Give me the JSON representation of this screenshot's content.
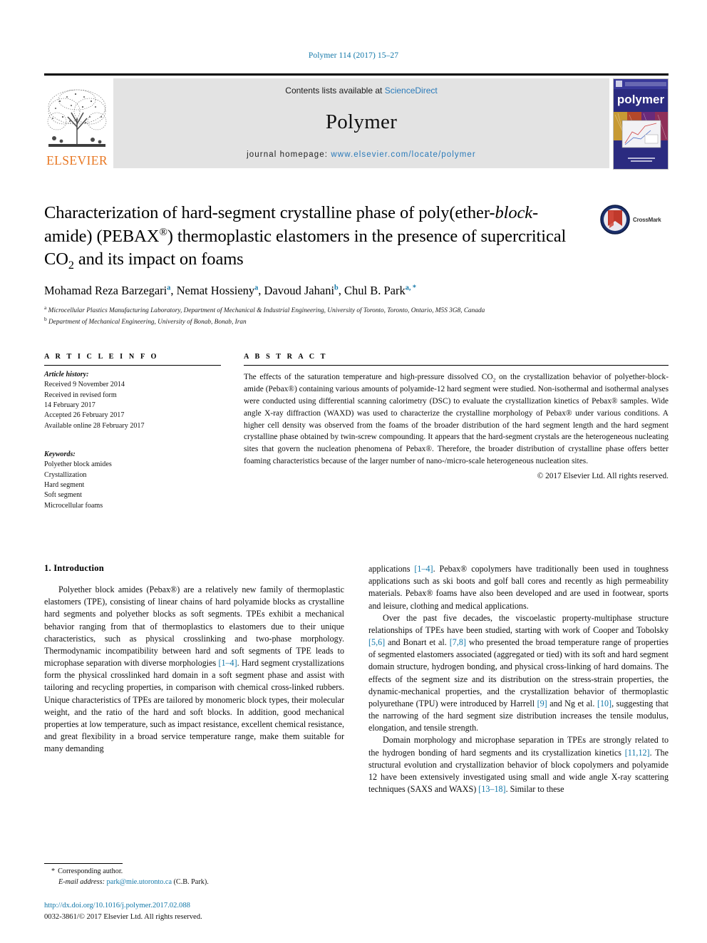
{
  "running_head": "Polymer 114 (2017) 15–27",
  "masthead": {
    "publisher_name": "ELSEVIER",
    "contents_line_prefix": "Contents lists available at ",
    "contents_link": "ScienceDirect",
    "journal_name": "Polymer",
    "homepage_label": "journal homepage: ",
    "homepage_url": "www.elsevier.com/locate/polymer",
    "cover_word": "polymer"
  },
  "crossmark": {
    "label": "CrossMark"
  },
  "title": {
    "line1": "Characterization of hard-segment crystalline phase of poly(ether-",
    "block_italic": "block",
    "line2_rest": "-amide) (PEBAX",
    "reg": "®",
    "line2_tail": ") thermoplastic elastomers in the presence of",
    "line3": "supercritical CO",
    "co2_sub": "2",
    "line3_tail": " and its impact on foams"
  },
  "authors": {
    "list": [
      {
        "name": "Mohamad Reza Barzegari",
        "sup": "a"
      },
      {
        "name": "Nemat Hossieny",
        "sup": "a"
      },
      {
        "name": "Davoud Jahani",
        "sup": "b"
      },
      {
        "name": "Chul B. Park",
        "sup": "a, *"
      }
    ]
  },
  "affiliations": [
    {
      "marker": "a",
      "text": "Microcellular Plastics Manufacturing Laboratory, Department of Mechanical & Industrial Engineering, University of Toronto, Toronto, Ontario, M5S 3G8, Canada"
    },
    {
      "marker": "b",
      "text": "Department of Mechanical Engineering, University of Bonab, Bonab, Iran"
    }
  ],
  "article_info": {
    "heading": "A R T I C L E   I N F O",
    "history_label": "Article history:",
    "history": [
      "Received 9 November 2014",
      "Received in revised form",
      "14 February 2017",
      "Accepted 26 February 2017",
      "Available online 28 February 2017"
    ],
    "keywords_label": "Keywords:",
    "keywords": [
      "Polyether block amides",
      "Crystallization",
      "Hard segment",
      "Soft segment",
      "Microcellular foams"
    ]
  },
  "abstract": {
    "heading": "A B S T R A C T",
    "paragraph_pre_sub": "The effects of the saturation temperature and high-pressure dissolved CO",
    "sub": "2",
    "paragraph_post": " on the crystallization behavior of polyether-block-amide (Pebax®) containing various amounts of polyamide-12 hard segment were studied. Non-isothermal and isothermal analyses were conducted using differential scanning calorimetry (DSC) to evaluate the crystallization kinetics of Pebax® samples. Wide angle X-ray diffraction (WAXD) was used to characterize the crystalline morphology of Pebax® under various conditions. A higher cell density was observed from the foams of the broader distribution of the hard segment length and the hard segment crystalline phase obtained by twin-screw compounding. It appears that the hard-segment crystals are the heterogeneous nucleating sites that govern the nucleation phenomena of Pebax®. Therefore, the broader distribution of crystalline phase offers better foaming characteristics because of the larger number of nano-/micro-scale heterogeneous nucleation sites.",
    "copyright": "© 2017 Elsevier Ltd. All rights reserved."
  },
  "body": {
    "section_number_title": "1. Introduction",
    "left_paragraph_1": "Polyether block amides (Pebax®) are a relatively new family of thermoplastic elastomers (TPE), consisting of linear chains of hard polyamide blocks as crystalline hard segments and polyether blocks as soft segments. TPEs exhibit a mechanical behavior ranging from that of thermoplastics to elastomers due to their unique characteristics, such as physical crosslinking and two-phase morphology. Thermodynamic incompatibility between hard and soft segments of TPE leads to microphase separation with diverse morphologies ",
    "cite_1_4": "[1–4]",
    "left_paragraph_1_cont": ". Hard segment crystallizations form the physical crosslinked hard domain in a soft segment phase and assist with tailoring and recycling properties, in comparison with chemical cross-linked rubbers. Unique characteristics of TPEs are tailored by monomeric block types, their molecular weight, and the ratio of the hard and soft blocks. In addition, good mechanical properties at low temperature, such as impact resistance, excellent chemical resistance, and great flexibility in a broad service temperature range, make them suitable for many demanding",
    "right_paragraph_1_start": "applications ",
    "right_cite_1_4": "[1–4]",
    "right_paragraph_1_cont": ". Pebax® copolymers have traditionally been used in toughness applications such as ski boots and golf ball cores and recently as high permeability materials. Pebax® foams have also been developed and are used in footwear, sports and leisure, clothing and medical applications.",
    "right_paragraph_2_a": "Over the past five decades, the viscoelastic property-multiphase structure relationships of TPEs have been studied, starting with work of Cooper and Tobolsky ",
    "cite_5_6": "[5,6]",
    "right_paragraph_2_b": " and Bonart et al. ",
    "cite_7_8": "[7,8]",
    "right_paragraph_2_c": " who presented the broad temperature range of properties of segmented elastomers associated (aggregated or tied) with its soft and hard segment domain structure, hydrogen bonding, and physical cross-linking of hard domains. The effects of the segment size and its distribution on the stress-strain properties, the dynamic-mechanical properties, and the crystallization behavior of thermoplastic polyurethane (TPU) were introduced by Harrell ",
    "cite_9": "[9]",
    "right_paragraph_2_d": " and Ng et al. ",
    "cite_10": "[10]",
    "right_paragraph_2_e": ", suggesting that the narrowing of the hard segment size distribution increases the tensile modulus, elongation, and tensile strength.",
    "right_paragraph_3_a": "Domain morphology and microphase separation in TPEs are strongly related to the hydrogen bonding of hard segments and its crystallization kinetics ",
    "cite_11_12": "[11,12]",
    "right_paragraph_3_b": ". The structural evolution and crystallization behavior of block copolymers and polyamide 12 have been extensively investigated using small and wide angle X-ray scattering techniques (SAXS and WAXS) ",
    "cite_13_18": "[13–18]",
    "right_paragraph_3_c": ". Similar to these"
  },
  "footnote": {
    "corresponding_marker": "*",
    "corresponding_text": "Corresponding author.",
    "email_label": "E-mail address: ",
    "email": "park@mie.utoronto.ca",
    "email_owner": " (C.B. Park)."
  },
  "doi": {
    "url": "http://dx.doi.org/10.1016/j.polymer.2017.02.088",
    "issn_line": "0032-3861/© 2017 Elsevier Ltd. All rights reserved."
  },
  "colors": {
    "link_blue": "#1277a8",
    "sd_blue": "#2a7ab9",
    "elsevier_orange": "#e87722",
    "banner_gray": "#e3e3e3",
    "cover_navy": "#2a2a78"
  }
}
